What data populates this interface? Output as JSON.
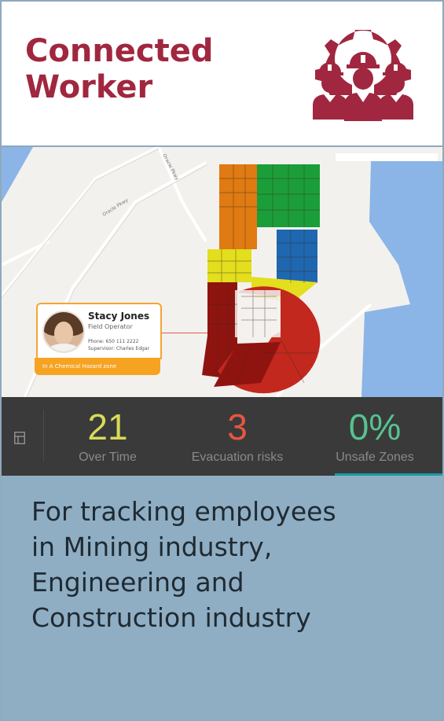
{
  "header": {
    "title_line1": "Connected",
    "title_line2": "Worker",
    "logo_icon": "workers-gear-icon",
    "accent_color": "#a0273f"
  },
  "map": {
    "street_label_1": "Oracle Pkwy",
    "street_label_2": "Oracle Pkwy",
    "zone_colors": [
      "#e07a12",
      "#1b9e3a",
      "#1f67b0",
      "#e3de1e",
      "#8f1410",
      "#c2281d"
    ],
    "worker_card": {
      "name": "Stacy Jones",
      "role": "Field Operator",
      "phone": "Phone: 650 111 2222",
      "supervisor": "Supervisor: Charles Edgar",
      "status": "In A Chemical Hazard zone",
      "status_color": "#f7a322"
    }
  },
  "stats": {
    "menu_icon": "dashboard-layout-icon",
    "items": [
      {
        "value": "21",
        "label": "Over Time",
        "color": "#d8da5a"
      },
      {
        "value": "3",
        "label": "Evacuation risks",
        "color": "#e8563f"
      },
      {
        "value": "0%",
        "label": "Unsafe Zones",
        "color": "#57c28f"
      }
    ]
  },
  "description": {
    "line1": "For tracking employees",
    "line2": "in Mining industry,",
    "line3": "Engineering and",
    "line4": "Construction industry"
  }
}
